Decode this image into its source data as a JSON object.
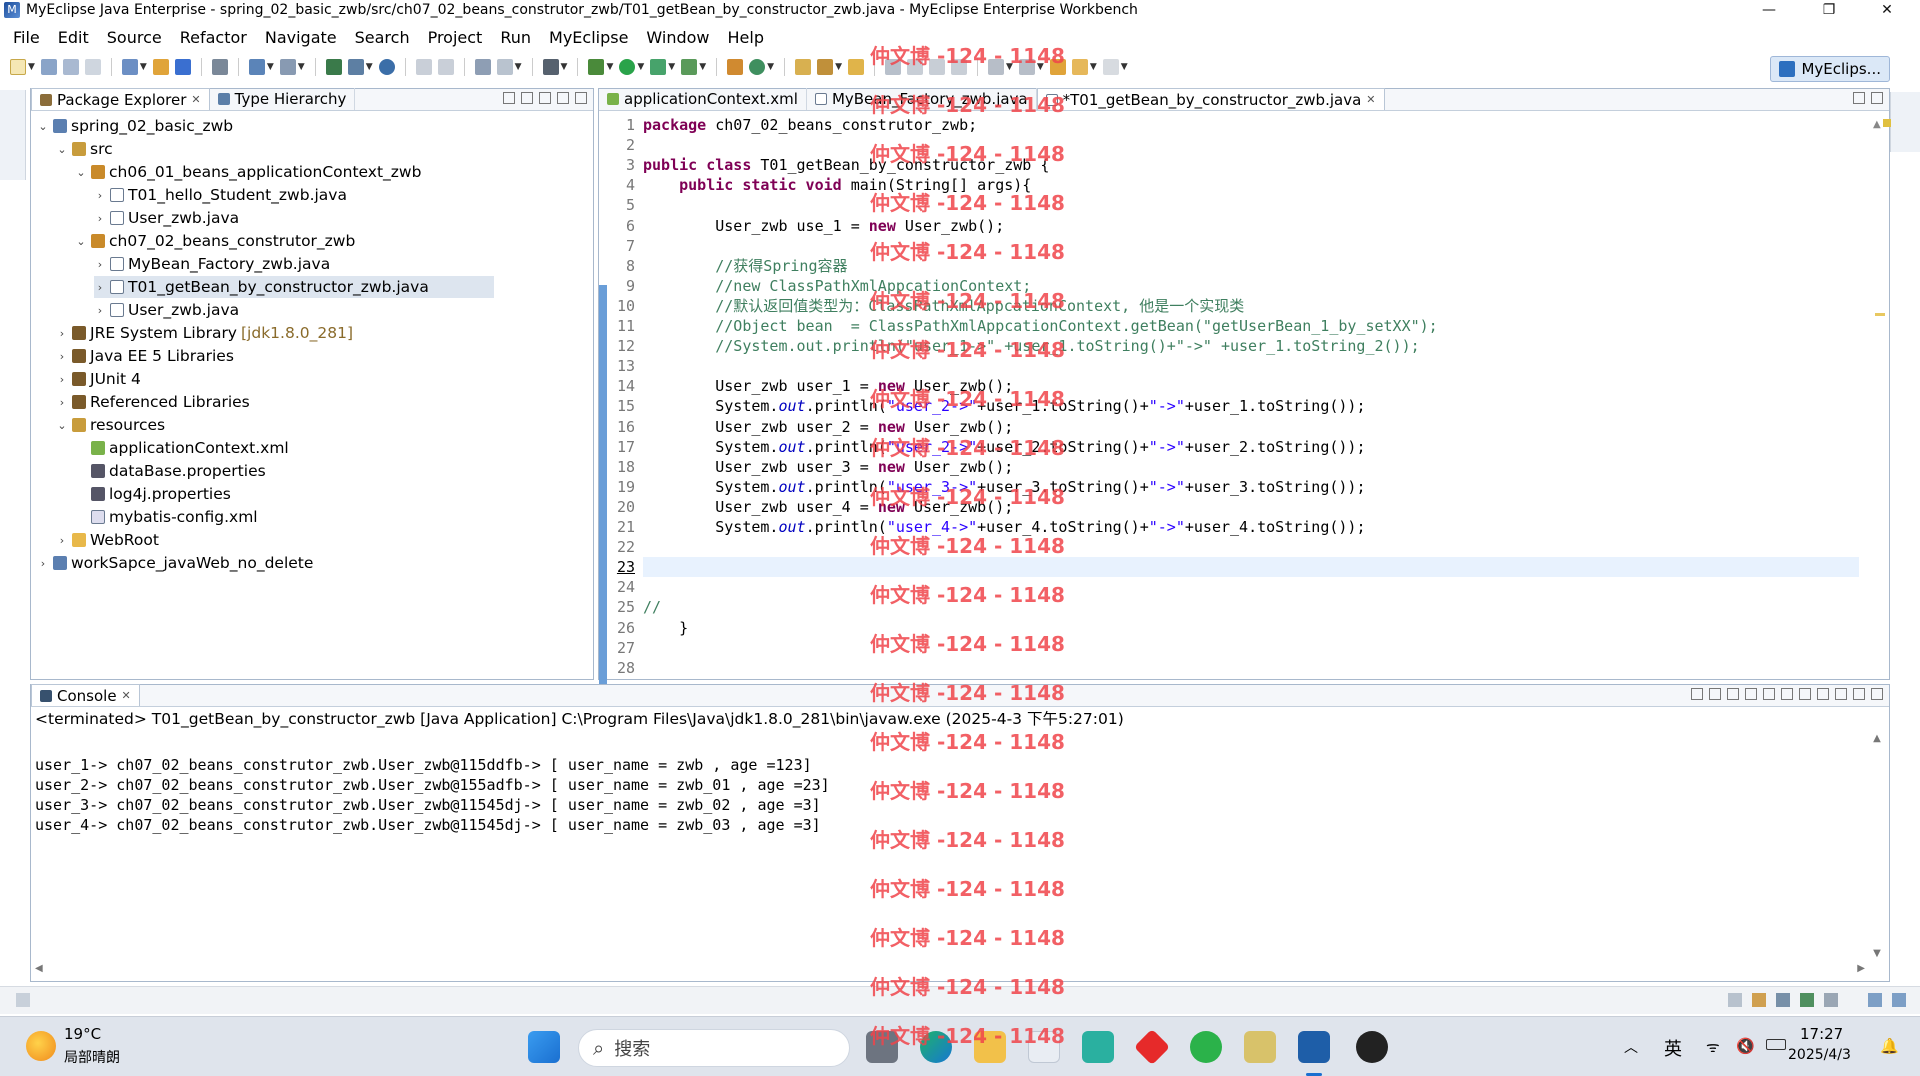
{
  "window": {
    "title": "MyEclipse Java Enterprise - spring_02_basic_zwb/src/ch07_02_beans_construtor_zwb/T01_getBean_by_constructor_zwb.java - MyEclipse Enterprise Workbench",
    "minimize": "—",
    "maximize": "❐",
    "close": "✕"
  },
  "menu": [
    "File",
    "Edit",
    "Source",
    "Refactor",
    "Navigate",
    "Search",
    "Project",
    "Run",
    "MyEclipse",
    "Window",
    "Help"
  ],
  "perspective": "MyEclips...",
  "explorer": {
    "tabs": [
      "Package Explorer",
      "Type Hierarchy"
    ],
    "tree": [
      {
        "label": "spring_02_basic_zwb",
        "depth": 0,
        "tw": "⌄",
        "icon": "project-icon"
      },
      {
        "label": "src",
        "depth": 1,
        "tw": "⌄",
        "icon": "source-folder-icon"
      },
      {
        "label": "ch06_01_beans_applicationContext_zwb",
        "depth": 2,
        "tw": "⌄",
        "icon": "package-icon"
      },
      {
        "label": "T01_hello_Student_zwb.java",
        "depth": 3,
        "tw": "›",
        "icon": "java-file-icon"
      },
      {
        "label": "User_zwb.java",
        "depth": 3,
        "tw": "›",
        "icon": "java-file-icon"
      },
      {
        "label": "ch07_02_beans_construtor_zwb",
        "depth": 2,
        "tw": "⌄",
        "icon": "package-icon"
      },
      {
        "label": "MyBean_Factory_zwb.java",
        "depth": 3,
        "tw": "›",
        "icon": "java-file-icon"
      },
      {
        "label": "T01_getBean_by_constructor_zwb.java",
        "depth": 3,
        "tw": "›",
        "icon": "java-file-icon",
        "selected": true
      },
      {
        "label": "User_zwb.java",
        "depth": 3,
        "tw": "›",
        "icon": "java-file-icon"
      },
      {
        "label": "JRE System Library",
        "extra": "[jdk1.8.0_281]",
        "depth": 1,
        "tw": "›",
        "icon": "library-icon"
      },
      {
        "label": "Java EE 5 Libraries",
        "depth": 1,
        "tw": "›",
        "icon": "library-icon"
      },
      {
        "label": "JUnit 4",
        "depth": 1,
        "tw": "›",
        "icon": "library-icon"
      },
      {
        "label": "Referenced Libraries",
        "depth": 1,
        "tw": "›",
        "icon": "library-icon"
      },
      {
        "label": "resources",
        "depth": 1,
        "tw": "⌄",
        "icon": "source-folder-icon"
      },
      {
        "label": "applicationContext.xml",
        "depth": 2,
        "tw": "",
        "icon": "xml-spring-icon"
      },
      {
        "label": "dataBase.properties",
        "depth": 2,
        "tw": "",
        "icon": "properties-file-icon"
      },
      {
        "label": "log4j.properties",
        "depth": 2,
        "tw": "",
        "icon": "properties-file-icon"
      },
      {
        "label": "mybatis-config.xml",
        "depth": 2,
        "tw": "",
        "icon": "xml-file-icon"
      },
      {
        "label": "WebRoot",
        "depth": 1,
        "tw": "›",
        "icon": "folder-icon"
      },
      {
        "label": "workSapce_javaWeb_no_delete",
        "depth": 0,
        "tw": "›",
        "icon": "project-icon"
      }
    ]
  },
  "editor": {
    "tabs": [
      {
        "label": "applicationContext.xml",
        "active": false
      },
      {
        "label": "MyBean_Factory_zwb.java",
        "active": false
      },
      {
        "label": "*T01_getBean_by_constructor_zwb.java",
        "active": true
      }
    ],
    "current_line": 23,
    "lines": [
      [
        [
          "kw",
          "package"
        ],
        [
          "",
          "ch07_02_beans_construtor_zwb;"
        ]
      ],
      [],
      [
        [
          "kw",
          "public class"
        ],
        [
          "",
          "T01_getBean_by_constructor_zwb {"
        ]
      ],
      [
        [
          "",
          "    "
        ],
        [
          "kw",
          "public static void"
        ],
        [
          "",
          "main(String[] args){"
        ]
      ],
      [],
      [
        [
          "",
          "        User_zwb use_1 = "
        ],
        [
          "kw",
          "new"
        ],
        [
          "",
          "User_zwb();"
        ]
      ],
      [],
      [
        [
          "cm",
          "        //获得Spring容器"
        ]
      ],
      [
        [
          "cm",
          "        //new ClassPathXmlAppcationContext;"
        ]
      ],
      [
        [
          "cm",
          "        //默认返回值类型为：ClassPathXmlAppcationContext, 他是一个实现类"
        ]
      ],
      [
        [
          "cm",
          "        //Object bean  = ClassPathXmlAppcationContext.getBean(\"getUserBean_1_by_setXX\");"
        ]
      ],
      [
        [
          "cm",
          "        //System.out.println(\"user_1->\" +user_1.toString()+\"->\" +user_1.toString_2());"
        ]
      ],
      [],
      [
        [
          "",
          "        User_zwb user_1 = "
        ],
        [
          "kw",
          "new"
        ],
        [
          "",
          "User_zwb();"
        ]
      ],
      [
        [
          "",
          "        System."
        ],
        [
          "fi",
          "out"
        ],
        [
          "",
          ".println("
        ],
        [
          "st",
          "\"user_2->\""
        ],
        [
          "",
          "+user_1.toString()+"
        ],
        [
          "st",
          "\"->\""
        ],
        [
          "",
          "+user_1.toString());"
        ]
      ],
      [
        [
          "",
          "        User_zwb user_2 = "
        ],
        [
          "kw",
          "new"
        ],
        [
          "",
          "User_zwb();"
        ]
      ],
      [
        [
          "",
          "        System."
        ],
        [
          "fi",
          "out"
        ],
        [
          "",
          ".println("
        ],
        [
          "st",
          "\"user_2->\""
        ],
        [
          "",
          "+user_2.toString()+"
        ],
        [
          "st",
          "\"->\""
        ],
        [
          "",
          "+user_2.toString());"
        ]
      ],
      [
        [
          "",
          "        User_zwb user_3 = "
        ],
        [
          "kw",
          "new"
        ],
        [
          "",
          "User_zwb();"
        ]
      ],
      [
        [
          "",
          "        System."
        ],
        [
          "fi",
          "out"
        ],
        [
          "",
          ".println("
        ],
        [
          "st",
          "\"user_3->\""
        ],
        [
          "",
          "+user_3.toString()+"
        ],
        [
          "st",
          "\"->\""
        ],
        [
          "",
          "+user_3.toString());"
        ]
      ],
      [
        [
          "",
          "        User_zwb user_4 = "
        ],
        [
          "kw",
          "new"
        ],
        [
          "",
          "User_zwb();"
        ]
      ],
      [
        [
          "",
          "        System."
        ],
        [
          "fi",
          "out"
        ],
        [
          "",
          ".println("
        ],
        [
          "st",
          "\"user_4->\""
        ],
        [
          "",
          "+user_4.toString()+"
        ],
        [
          "st",
          "\"->\""
        ],
        [
          "",
          "+user_4.toString());"
        ]
      ],
      [],
      [],
      [],
      [
        [
          "cm",
          "//"
        ]
      ],
      [
        [
          "",
          "    }"
        ]
      ],
      [],
      []
    ]
  },
  "console": {
    "tab": "Console",
    "header": "<terminated> T01_getBean_by_constructor_zwb [Java Application] C:\\Program Files\\Java\\jdk1.8.0_281\\bin\\javaw.exe (2025-4-3 下午5:27:01)",
    "lines": [
      "",
      "user_1-> ch07_02_beans_construtor_zwb.User_zwb@115ddfb-> [ user_name = zwb , age =123]",
      "user_2-> ch07_02_beans_construtor_zwb.User_zwb@155adfb-> [ user_name = zwb_01 , age =23]",
      "user_3-> ch07_02_beans_construtor_zwb.User_zwb@11545dj-> [ user_name = zwb_02 , age =3]",
      "user_4-> ch07_02_beans_construtor_zwb.User_zwb@11545dj-> [ user_name = zwb_03 , age =3]"
    ]
  },
  "watermark": "仲文博 -124 - 1148",
  "taskbar": {
    "weather_temp": "19°C",
    "weather_desc": "局部晴朗",
    "search_placeholder": "搜索",
    "ime": "英",
    "time": "17:27",
    "date": "2025/4/3"
  },
  "colors": {
    "keyword": "#7f0055",
    "comment": "#3f7f5f",
    "string": "#2a00ff",
    "field": "#0000c0",
    "watermark": "#f0454b"
  }
}
